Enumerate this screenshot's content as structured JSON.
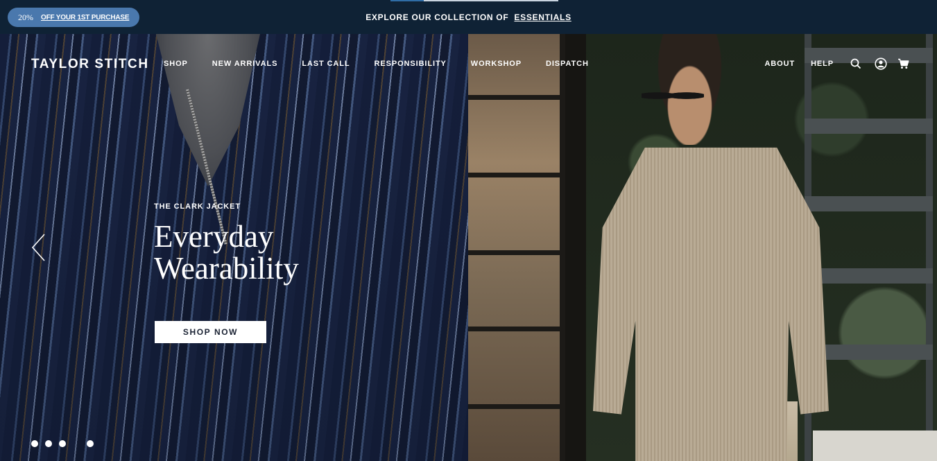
{
  "promo": {
    "discount_pct": "20%",
    "discount_offer": "OFF YOUR 1ST PURCHASE",
    "message_prefix": "EXPLORE OUR COLLECTION OF",
    "message_link": "ESSENTIALS"
  },
  "nav": {
    "logo": "TAYLOR STITCH",
    "links": [
      "SHOP",
      "NEW ARRIVALS",
      "LAST CALL",
      "RESPONSIBILITY",
      "WORKSHOP",
      "DISPATCH"
    ],
    "right_links": [
      "ABOUT",
      "HELP"
    ],
    "icons": [
      "search-icon",
      "account-icon",
      "cart-icon"
    ]
  },
  "hero": {
    "eyebrow": "THE CLARK JACKET",
    "headline_line1": "Everyday",
    "headline_line2": "Wearability",
    "cta": "SHOP NOW",
    "slide_count": 4
  },
  "colors": {
    "promo_bg": "#0f2235",
    "pill_bg": "#4a78ad",
    "button_bg": "#ffffff",
    "button_text": "#1a2233"
  }
}
